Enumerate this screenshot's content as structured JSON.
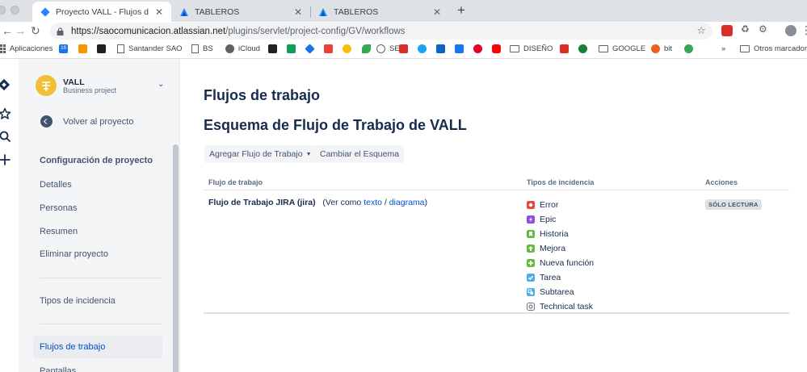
{
  "browser": {
    "tabs": [
      {
        "title": "Proyecto VALL - Flujos de Trab",
        "active": true
      },
      {
        "title": "TABLEROS",
        "active": false
      },
      {
        "title": "TABLEROS",
        "active": false
      }
    ],
    "url_host": "https://saocomunicacion.atlassian.net",
    "url_path": "/plugins/servlet/project-config/GV/workflows",
    "bookmarks": [
      "Aplicaciones",
      "Santander SAO",
      "BS",
      "iCloud",
      "SEO",
      "DISEÑO",
      "GOOGLE",
      "bit",
      "Otros marcadores"
    ],
    "bookmark_badge": "19",
    "more_glyph": "»"
  },
  "project": {
    "name": "VALL",
    "type": "Business project",
    "back_label": "Volver al proyecto"
  },
  "sidebar": {
    "section_title": "Configuración de proyecto",
    "items": [
      "Detalles",
      "Personas",
      "Resumen",
      "Eliminar proyecto"
    ],
    "group2": [
      "Tipos de incidencia"
    ],
    "group3": [
      "Flujos de trabajo",
      "Pantallas"
    ]
  },
  "main": {
    "title": "Flujos de trabajo",
    "scheme_title": "Esquema de Flujo de Trabajo de VALL",
    "add_workflow": "Agregar Flujo de Trabajo",
    "change_scheme": "Cambiar el Esquema",
    "columns": [
      "Flujo de trabajo",
      "Tipos de incidencia",
      "Acciones"
    ],
    "row": {
      "name": "Flujo de Trabajo JIRA (jira)",
      "view_prefix": "(Ver como",
      "view_text": "texto",
      "sep": "/",
      "view_diagram": "diagrama",
      "view_suffix": ")",
      "status": "SÓLO LECTURA"
    },
    "issue_types": [
      {
        "label": "Error",
        "color": "#e5493a"
      },
      {
        "label": "Epic",
        "color": "#904ee2"
      },
      {
        "label": "Historia",
        "color": "#63ba3c"
      },
      {
        "label": "Mejora",
        "color": "#63ba3c"
      },
      {
        "label": "Nueva función",
        "color": "#63ba3c"
      },
      {
        "label": "Tarea",
        "color": "#4bade8"
      },
      {
        "label": "Subtarea",
        "color": "#4bade8"
      },
      {
        "label": "Technical task",
        "color": "#6b778c"
      }
    ]
  }
}
